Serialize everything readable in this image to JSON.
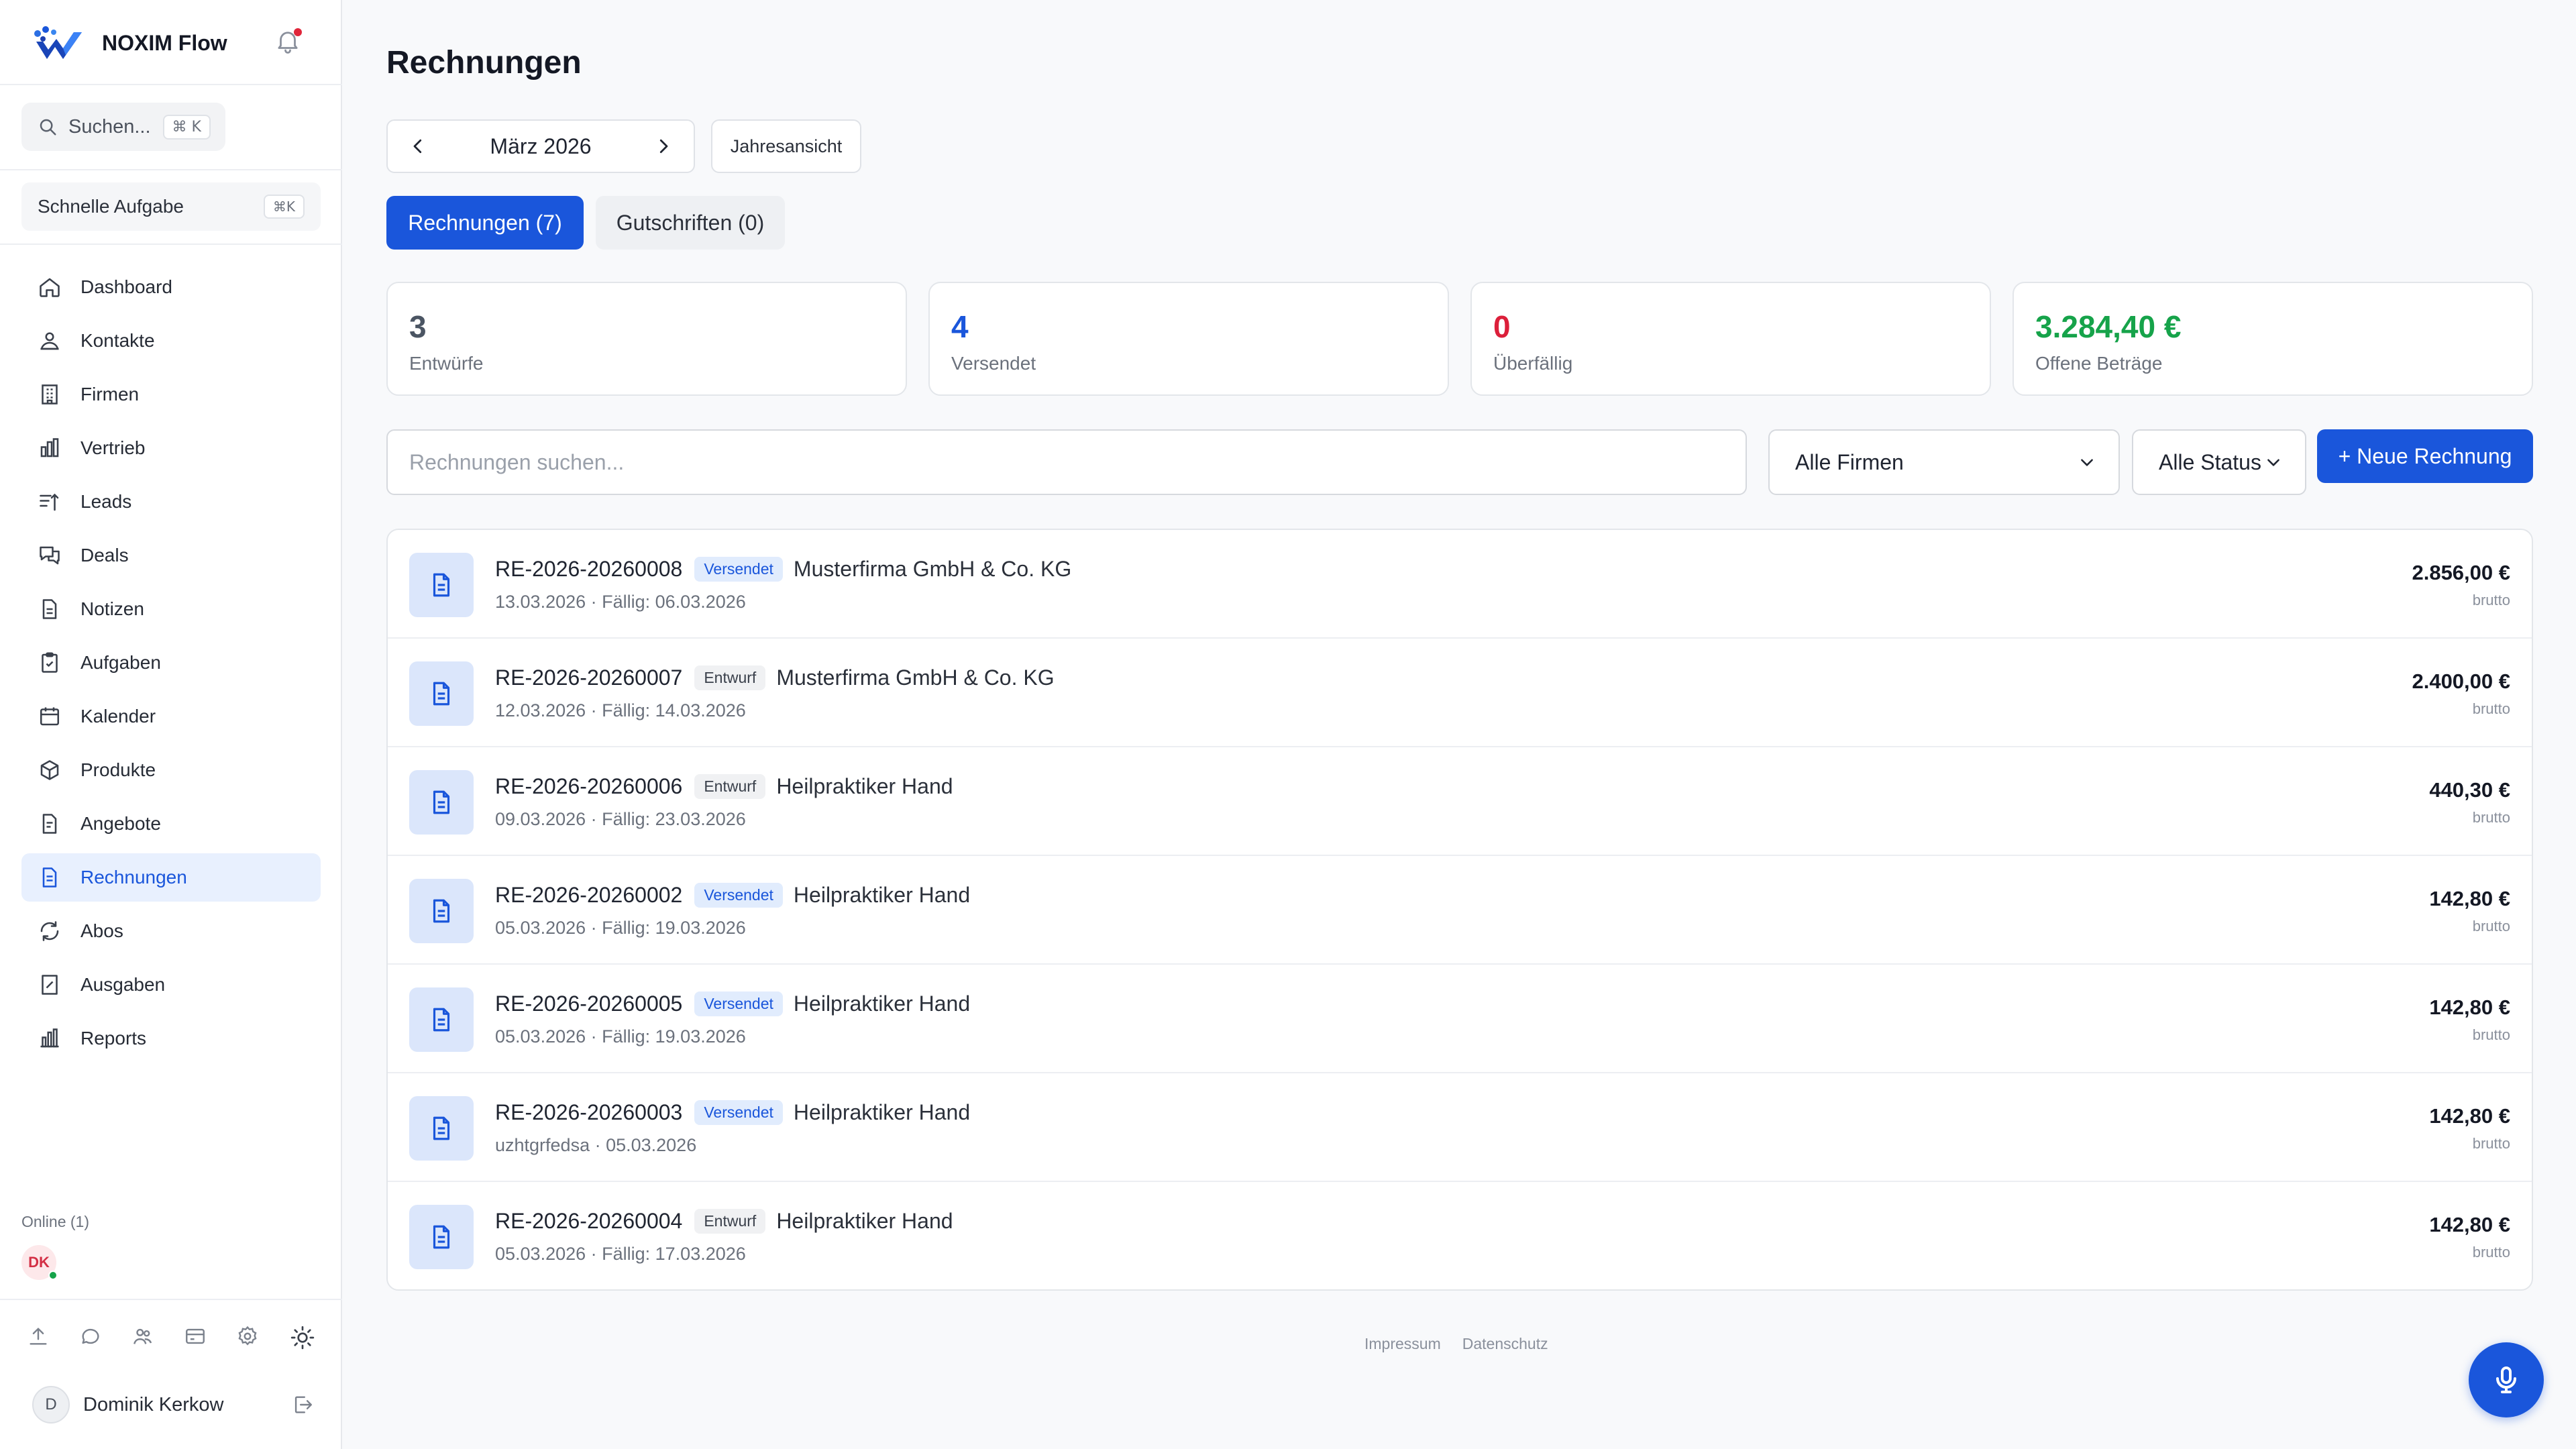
{
  "app": {
    "name": "NOXIM Flow"
  },
  "sidebar": {
    "search_label": "Suchen...",
    "search_shortcut": "⌘ K",
    "quick_task_label": "Schnelle Aufgabe",
    "quick_task_shortcut": "⌘K",
    "items": [
      {
        "label": "Dashboard",
        "icon": "home-icon"
      },
      {
        "label": "Kontakte",
        "icon": "contacts-icon"
      },
      {
        "label": "Firmen",
        "icon": "building-icon"
      },
      {
        "label": "Vertrieb",
        "icon": "bar-chart-icon"
      },
      {
        "label": "Leads",
        "icon": "sort-icon"
      },
      {
        "label": "Deals",
        "icon": "chat-icon"
      },
      {
        "label": "Notizen",
        "icon": "note-icon"
      },
      {
        "label": "Aufgaben",
        "icon": "clipboard-icon"
      },
      {
        "label": "Kalender",
        "icon": "calendar-icon"
      },
      {
        "label": "Produkte",
        "icon": "box-icon"
      },
      {
        "label": "Angebote",
        "icon": "quote-icon"
      },
      {
        "label": "Rechnungen",
        "icon": "invoice-icon",
        "active": true
      },
      {
        "label": "Abos",
        "icon": "refresh-icon"
      },
      {
        "label": "Ausgaben",
        "icon": "receipt-icon"
      },
      {
        "label": "Reports",
        "icon": "reports-icon"
      }
    ],
    "online_label": "Online (1)",
    "online_user_initials": "DK",
    "user": {
      "initial": "D",
      "name": "Dominik Kerkow"
    }
  },
  "main": {
    "title": "Rechnungen",
    "month": "März 2026",
    "year_view_label": "Jahresansicht",
    "tabs": [
      {
        "label": "Rechnungen (7)",
        "active": true
      },
      {
        "label": "Gutschriften (0)",
        "active": false
      }
    ],
    "stats": [
      {
        "value": "3",
        "label": "Entwürfe",
        "color": "#4b5563"
      },
      {
        "value": "4",
        "label": "Versendet",
        "color": "#1a56db"
      },
      {
        "value": "0",
        "label": "Überfällig",
        "color": "#dc1f3a"
      },
      {
        "value": "3.284,40 €",
        "label": "Offene Beträge",
        "color": "#16a34a"
      }
    ],
    "search_placeholder": "Rechnungen suchen...",
    "filter_company": "Alle Firmen",
    "filter_status": "Alle Status",
    "new_invoice_label": "+ Neue Rechnung",
    "invoices": [
      {
        "number": "RE-2026-20260008",
        "status": "Versendet",
        "company": "Musterfirma GmbH & Co. KG",
        "meta": "13.03.2026 · Fällig: 06.03.2026",
        "amount": "2.856,00 €",
        "amount_note": "brutto"
      },
      {
        "number": "RE-2026-20260007",
        "status": "Entwurf",
        "company": "Musterfirma GmbH & Co. KG",
        "meta": "12.03.2026 · Fällig: 14.03.2026",
        "amount": "2.400,00 €",
        "amount_note": "brutto"
      },
      {
        "number": "RE-2026-20260006",
        "status": "Entwurf",
        "company": "Heilpraktiker Hand",
        "meta": "09.03.2026 · Fällig: 23.03.2026",
        "amount": "440,30 €",
        "amount_note": "brutto"
      },
      {
        "number": "RE-2026-20260002",
        "status": "Versendet",
        "company": "Heilpraktiker Hand",
        "meta": "05.03.2026 · Fällig: 19.03.2026",
        "amount": "142,80 €",
        "amount_note": "brutto"
      },
      {
        "number": "RE-2026-20260005",
        "status": "Versendet",
        "company": "Heilpraktiker Hand",
        "meta": "05.03.2026 · Fällig: 19.03.2026",
        "amount": "142,80 €",
        "amount_note": "brutto"
      },
      {
        "number": "RE-2026-20260003",
        "status": "Versendet",
        "company": "Heilpraktiker Hand",
        "meta": "uzhtgrfedsa · 05.03.2026",
        "amount": "142,80 €",
        "amount_note": "brutto"
      },
      {
        "number": "RE-2026-20260004",
        "status": "Entwurf",
        "company": "Heilpraktiker Hand",
        "meta": "05.03.2026 · Fällig: 17.03.2026",
        "amount": "142,80 €",
        "amount_note": "brutto"
      }
    ],
    "footer": {
      "impressum": "Impressum",
      "datenschutz": "Datenschutz"
    }
  }
}
